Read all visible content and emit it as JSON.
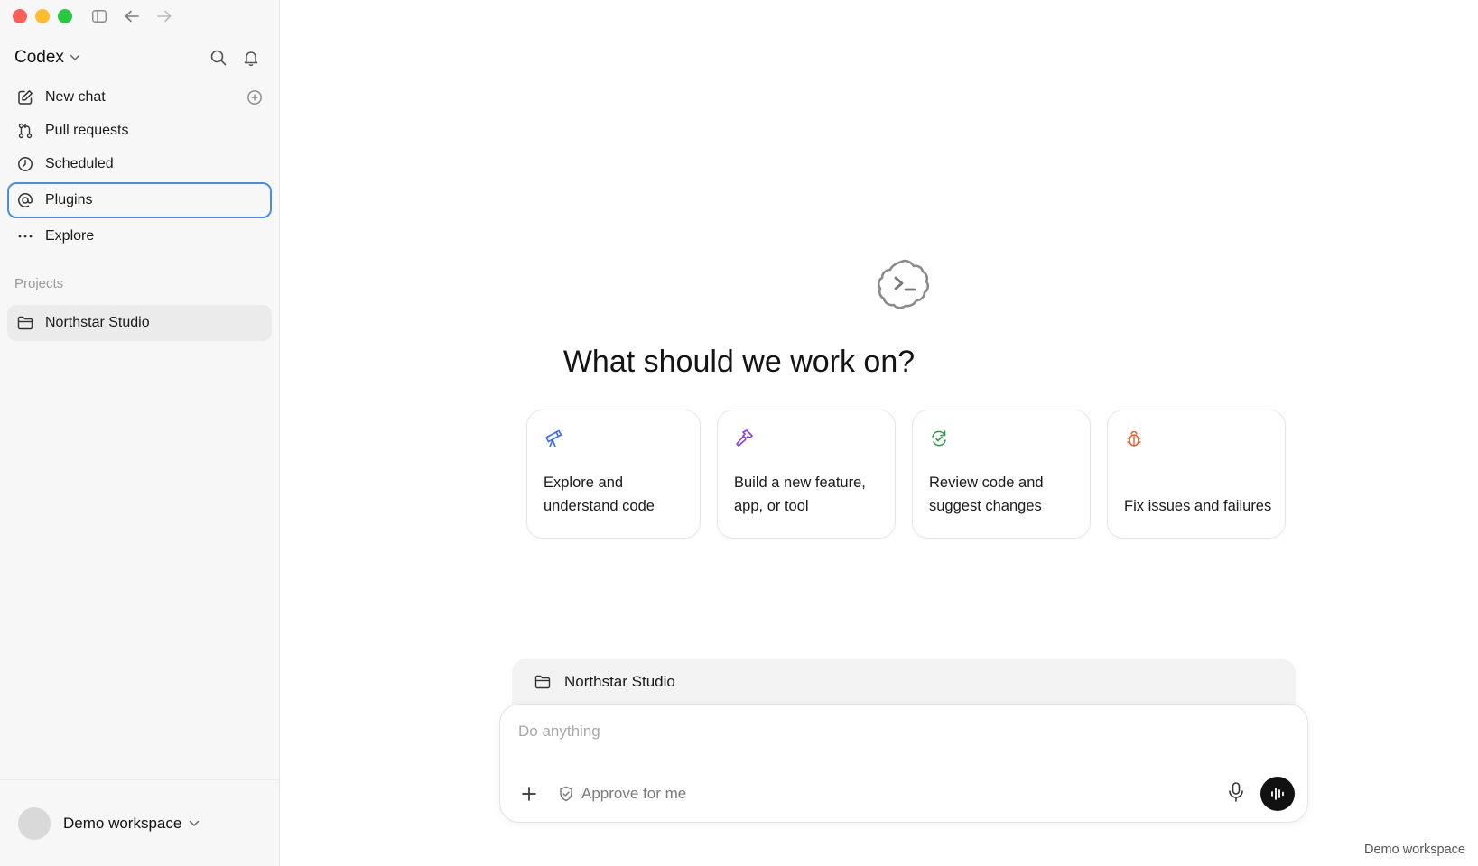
{
  "window": {
    "controls": [
      "close",
      "minimize",
      "zoom"
    ],
    "toolbar_icons": [
      "sidebar-toggle-icon",
      "back-arrow-icon",
      "forward-arrow-icon"
    ]
  },
  "sidebar": {
    "app_name": "Codex",
    "nav": [
      {
        "label": "New chat",
        "icon": "compose-icon"
      },
      {
        "label": "Pull requests",
        "icon": "pull-request-icon"
      },
      {
        "label": "Scheduled",
        "icon": "clock-icon"
      },
      {
        "label": "Plugins",
        "icon": "at-sign-icon",
        "active": true
      },
      {
        "label": "Explore",
        "icon": "more-dots-icon"
      }
    ],
    "projects_label": "Projects",
    "projects": [
      {
        "label": "Northstar Studio",
        "icon": "folder-icon"
      }
    ],
    "footer": {
      "workspace": "Demo workspace"
    }
  },
  "main": {
    "headline": "What should we work on?",
    "cards": [
      {
        "label": "Explore and understand code",
        "icon": "telescope-icon",
        "color": "#3b6fe0"
      },
      {
        "label": "Build a new feature, app, or tool",
        "icon": "hammer-icon",
        "color": "#8a3fe0"
      },
      {
        "label": "Review code and suggest changes",
        "icon": "review-cycle-icon",
        "color": "#2e9a4a"
      },
      {
        "label": "Fix issues and failures",
        "icon": "bug-icon",
        "color": "#e0622e"
      }
    ],
    "context_project": "Northstar Studio",
    "composer": {
      "placeholder": "Do anything",
      "approve_label": "Approve for me"
    },
    "corner_label": "Demo workspace"
  }
}
